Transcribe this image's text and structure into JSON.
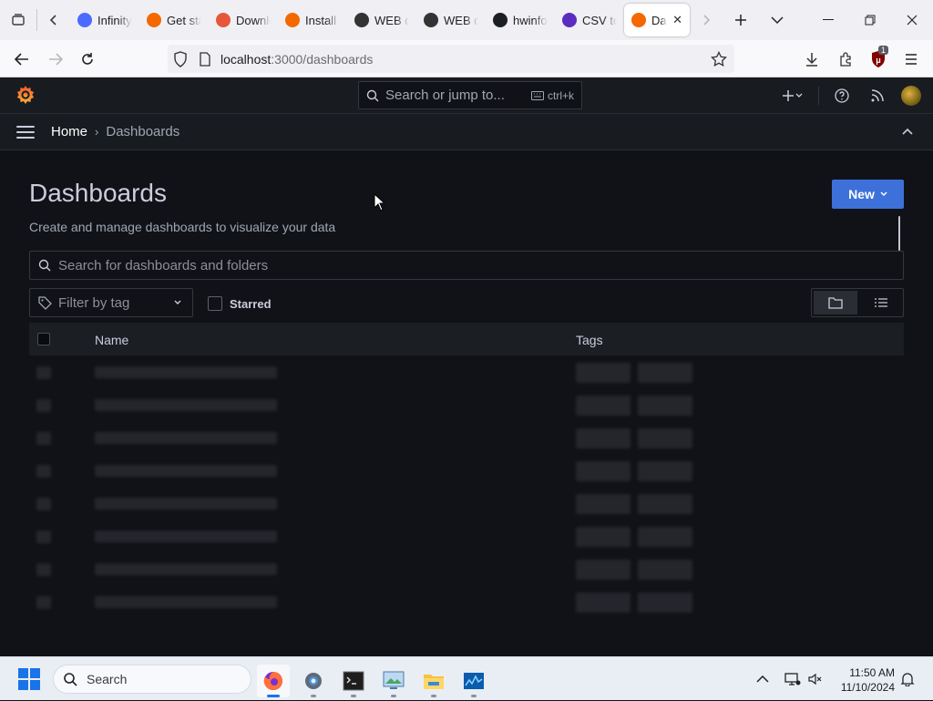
{
  "browser": {
    "tabs": [
      {
        "label": "Infinity",
        "icon": "infinity-icon",
        "color": "#4b6bff"
      },
      {
        "label": "Get started",
        "icon": "grafana-icon",
        "color": "#f46800"
      },
      {
        "label": "Download",
        "icon": "drop-icon",
        "color": "#e8563a"
      },
      {
        "label": "Install",
        "icon": "grafana-icon",
        "color": "#f46800"
      },
      {
        "label": "WEB data",
        "icon": "eye-icon",
        "color": "#333333"
      },
      {
        "label": "WEB data",
        "icon": "eye-icon",
        "color": "#333333"
      },
      {
        "label": "hwinfo",
        "icon": "github-icon",
        "color": "#1b1f23"
      },
      {
        "label": "CSV to",
        "icon": "csv-icon",
        "color": "#5b2dbf"
      }
    ],
    "active_tab": {
      "label": "Dashboards",
      "icon": "grafana-icon",
      "color": "#f46800"
    },
    "url": {
      "host": "localhost",
      "path": ":3000/dashboards"
    },
    "extension_badge": "1"
  },
  "grafana": {
    "search": {
      "placeholder": "Search or jump to...",
      "shortcut": "ctrl+k"
    },
    "breadcrumb": {
      "home": "Home",
      "current": "Dashboards"
    }
  },
  "page": {
    "title": "Dashboards",
    "subtitle": "Create and manage dashboards to visualize your data",
    "new_button": "New",
    "search_placeholder": "Search for dashboards and folders",
    "filter_tag_placeholder": "Filter by tag",
    "starred_label": "Starred",
    "table": {
      "col_name": "Name",
      "col_tags": "Tags",
      "loading_rows": 8
    }
  },
  "taskbar": {
    "search_placeholder": "Search",
    "time": "11:50 AM",
    "date": "11/10/2024",
    "accent": "#1a73e8"
  }
}
